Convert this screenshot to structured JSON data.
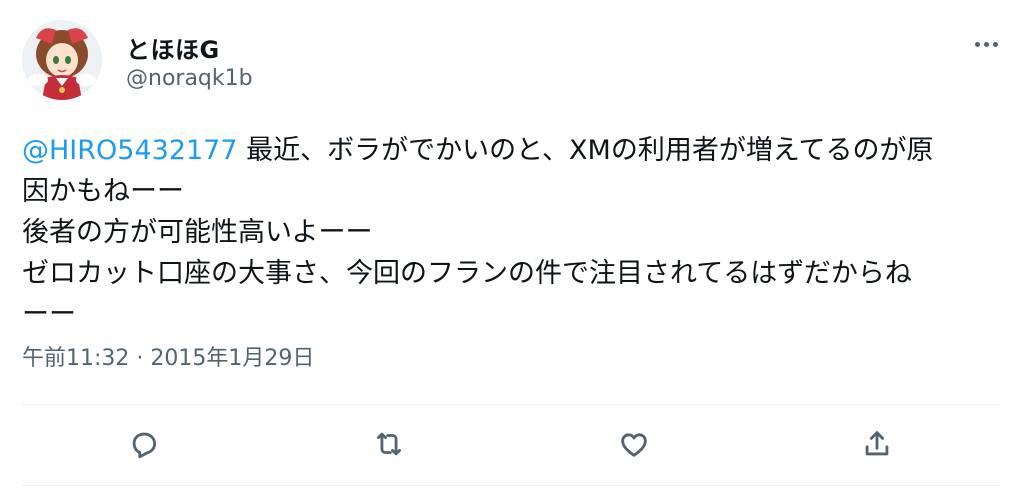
{
  "author": {
    "display_name": "とほほG",
    "handle": "@noraqk1b"
  },
  "tweet": {
    "mention": "@HIRO5432177",
    "lines": [
      " 最近、ボラがでかいのと、XMの利用者が増えてるのが原",
      "因かもねーー",
      "後者の方が可能性高いよーー",
      "ゼロカット口座の大事さ、今回のフランの件で注目されてるはずだからね",
      "ーー"
    ]
  },
  "meta": {
    "timestamp": "午前11:32 · 2015年1月29日"
  },
  "icons": {
    "more": "more-horizontal-icon",
    "reply": "reply-icon",
    "retweet": "retweet-icon",
    "like": "heart-icon",
    "share": "share-icon"
  },
  "colors": {
    "text": "#0f1419",
    "secondary": "#536471",
    "mention": "#1d9bf0",
    "divider": "#eff3f4"
  }
}
